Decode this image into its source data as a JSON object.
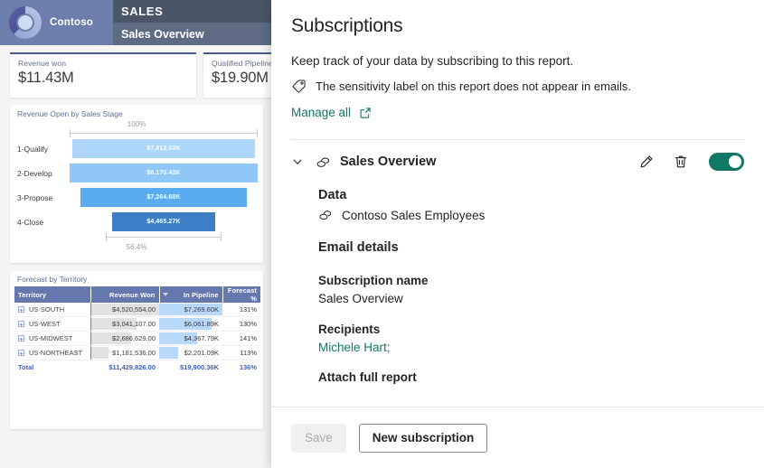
{
  "report": {
    "brand": "Contoso",
    "workspace": "SALES",
    "report_name": "Sales Overview",
    "kpis": [
      {
        "label": "Revenue won",
        "value": "$11.43M"
      },
      {
        "label": "Qualified Pipeline",
        "value": "$19.90M"
      }
    ],
    "funnel": {
      "title": "Revenue Open by Sales Stage",
      "top_percent": "100%",
      "bottom_percent": "56.4%",
      "rows": [
        {
          "category": "1-Qualify",
          "value": "$7,912.02K",
          "pct": 100.0,
          "color": "#aed6fa"
        },
        {
          "category": "2-Develop",
          "value": "$8,170.42K",
          "pct": 103.3,
          "color": "#8fc8f8"
        },
        {
          "category": "3-Propose",
          "value": "$7,264.68K",
          "pct": 91.8,
          "color": "#5aabf0"
        },
        {
          "category": "4-Close",
          "value": "$4,465.27K",
          "pct": 56.4,
          "color": "#3d7fc4"
        }
      ]
    },
    "table": {
      "title": "Forecast by Territory",
      "columns": [
        "Territory",
        "Revenue Won",
        "In Pipeline",
        "Forecast %"
      ],
      "sorted_column": "In Pipeline",
      "rows": [
        {
          "territory": "US-SOUTH",
          "revenue_won": "$4,520,554.00",
          "in_pipeline": "$7,269.60K",
          "forecast_pct": "131%",
          "rw_bar": 100,
          "ip_bar": 100
        },
        {
          "territory": "US-WEST",
          "revenue_won": "$3,041,107.00",
          "in_pipeline": "$6,061.89K",
          "forecast_pct": "130%",
          "rw_bar": 67,
          "ip_bar": 83
        },
        {
          "territory": "US-MIDWEST",
          "revenue_won": "$2,686,629.00",
          "in_pipeline": "$4,367.79K",
          "forecast_pct": "141%",
          "rw_bar": 59,
          "ip_bar": 60
        },
        {
          "territory": "US-NORTHEAST",
          "revenue_won": "$1,181,536.00",
          "in_pipeline": "$2,201.09K",
          "forecast_pct": "113%",
          "rw_bar": 26,
          "ip_bar": 30
        }
      ],
      "total": {
        "territory": "Total",
        "revenue_won": "$11,429,826.00",
        "in_pipeline": "$19,900.36K",
        "forecast_pct": "136%"
      }
    }
  },
  "panel": {
    "title": "Subscriptions",
    "description": "Keep track of your data by subscribing to this report.",
    "sensitivity_note": "The sensitivity label on this report does not appear in emails.",
    "manage_all_label": "Manage all",
    "subscription": {
      "name": "Sales Overview",
      "enabled": true,
      "edit_title": "Edit",
      "delete_title": "Delete",
      "data_heading": "Data",
      "data_source": "Contoso Sales Employees",
      "email_details_heading": "Email details",
      "subscription_name_label": "Subscription name",
      "subscription_name_value": "Sales Overview",
      "recipients_label": "Recipients",
      "recipients_value": "Michele Hart;",
      "attach_label": "Attach full report"
    },
    "footer": {
      "save_label": "Save",
      "new_subscription_label": "New subscription"
    },
    "accent_color": "#117865"
  }
}
